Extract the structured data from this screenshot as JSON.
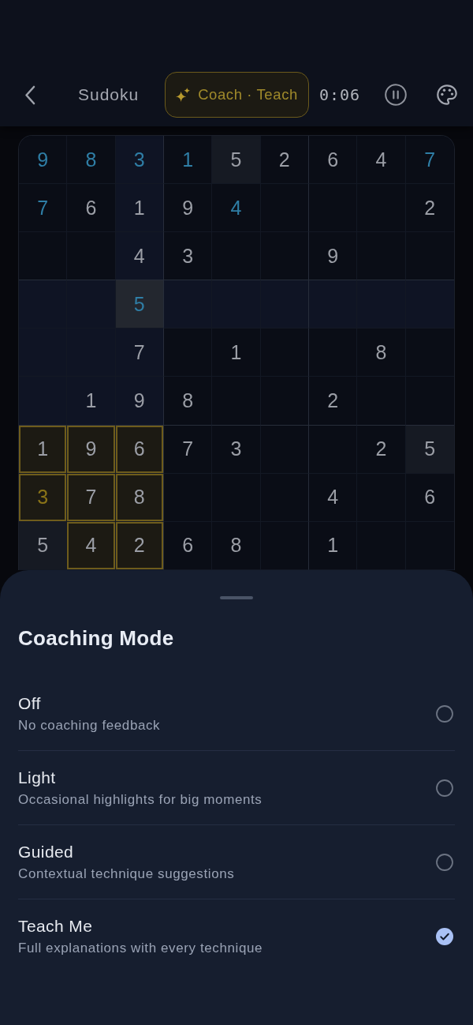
{
  "header": {
    "title": "Sudoku",
    "coach_badge": "Coach · Teach",
    "timer": "0:06"
  },
  "board": {
    "rows": [
      [
        {
          "value": "9",
          "kind": "entered",
          "selected": false,
          "coach": false
        },
        {
          "value": "8",
          "kind": "entered",
          "selected": false,
          "coach": false
        },
        {
          "value": "3",
          "kind": "entered",
          "selected": false,
          "coach": false
        },
        {
          "value": "1",
          "kind": "entered",
          "selected": false,
          "coach": false
        },
        {
          "value": "5",
          "kind": "given",
          "selected": false,
          "coach": false
        },
        {
          "value": "2",
          "kind": "given",
          "selected": false,
          "coach": false
        },
        {
          "value": "6",
          "kind": "given",
          "selected": false,
          "coach": false
        },
        {
          "value": "4",
          "kind": "given",
          "selected": false,
          "coach": false
        },
        {
          "value": "7",
          "kind": "entered",
          "selected": false,
          "coach": false
        }
      ],
      [
        {
          "value": "7",
          "kind": "entered",
          "selected": false,
          "coach": false
        },
        {
          "value": "6",
          "kind": "given",
          "selected": false,
          "coach": false
        },
        {
          "value": "1",
          "kind": "given",
          "selected": false,
          "coach": false
        },
        {
          "value": "9",
          "kind": "given",
          "selected": false,
          "coach": false
        },
        {
          "value": "4",
          "kind": "entered",
          "selected": false,
          "coach": false
        },
        {
          "selected": false,
          "coach": false
        },
        {
          "selected": false,
          "coach": false
        },
        {
          "selected": false,
          "coach": false
        },
        {
          "value": "2",
          "kind": "given",
          "selected": false,
          "coach": false
        }
      ],
      [
        {
          "selected": false,
          "coach": false
        },
        {
          "selected": false,
          "coach": false
        },
        {
          "value": "4",
          "kind": "given",
          "selected": false,
          "coach": false
        },
        {
          "value": "3",
          "kind": "given",
          "selected": false,
          "coach": false
        },
        {
          "selected": false,
          "coach": false
        },
        {
          "selected": false,
          "coach": false
        },
        {
          "value": "9",
          "kind": "given",
          "selected": false,
          "coach": false
        },
        {
          "selected": false,
          "coach": false
        },
        {
          "selected": false,
          "coach": false
        }
      ],
      [
        {
          "selected": false,
          "coach": false
        },
        {
          "selected": false,
          "coach": false
        },
        {
          "value": "5",
          "kind": "entered",
          "selected": true,
          "coach": false
        },
        {
          "selected": false,
          "coach": false
        },
        {
          "selected": false,
          "coach": false
        },
        {
          "selected": false,
          "coach": false
        },
        {
          "selected": false,
          "coach": false
        },
        {
          "selected": false,
          "coach": false
        },
        {
          "selected": false,
          "coach": false
        }
      ],
      [
        {
          "selected": false,
          "coach": false
        },
        {
          "selected": false,
          "coach": false
        },
        {
          "value": "7",
          "kind": "given",
          "selected": false,
          "coach": false
        },
        {
          "selected": false,
          "coach": false
        },
        {
          "value": "1",
          "kind": "given",
          "selected": false,
          "coach": false
        },
        {
          "selected": false,
          "coach": false
        },
        {
          "selected": false,
          "coach": false
        },
        {
          "value": "8",
          "kind": "given",
          "selected": false,
          "coach": false
        },
        {
          "selected": false,
          "coach": false
        }
      ],
      [
        {
          "selected": false,
          "coach": false
        },
        {
          "value": "1",
          "kind": "given",
          "selected": false,
          "coach": false
        },
        {
          "value": "9",
          "kind": "given",
          "selected": false,
          "coach": false
        },
        {
          "value": "8",
          "kind": "given",
          "selected": false,
          "coach": false
        },
        {
          "selected": false,
          "coach": false
        },
        {
          "selected": false,
          "coach": false
        },
        {
          "value": "2",
          "kind": "given",
          "selected": false,
          "coach": false
        },
        {
          "selected": false,
          "coach": false
        },
        {
          "selected": false,
          "coach": false
        }
      ],
      [
        {
          "value": "1",
          "kind": "given",
          "selected": false,
          "coach": true
        },
        {
          "value": "9",
          "kind": "given",
          "selected": false,
          "coach": true
        },
        {
          "value": "6",
          "kind": "given",
          "selected": false,
          "coach": true
        },
        {
          "value": "7",
          "kind": "given",
          "selected": false,
          "coach": false
        },
        {
          "value": "3",
          "kind": "given",
          "selected": false,
          "coach": false
        },
        {
          "selected": false,
          "coach": false
        },
        {
          "selected": false,
          "coach": false
        },
        {
          "value": "2",
          "kind": "given",
          "selected": false,
          "coach": false
        },
        {
          "value": "5",
          "kind": "given",
          "selected": false,
          "coach": false
        }
      ],
      [
        {
          "value": "3",
          "kind": "hint",
          "selected": false,
          "coach": true
        },
        {
          "value": "7",
          "kind": "given",
          "selected": false,
          "coach": true
        },
        {
          "value": "8",
          "kind": "given",
          "selected": false,
          "coach": true
        },
        {
          "selected": false,
          "coach": false
        },
        {
          "selected": false,
          "coach": false
        },
        {
          "selected": false,
          "coach": false
        },
        {
          "value": "4",
          "kind": "given",
          "selected": false,
          "coach": false
        },
        {
          "selected": false,
          "coach": false
        },
        {
          "value": "6",
          "kind": "given",
          "selected": false,
          "coach": false
        }
      ],
      [
        {
          "value": "5",
          "kind": "given",
          "selected": false,
          "coach": false
        },
        {
          "value": "4",
          "kind": "given",
          "selected": false,
          "coach": true
        },
        {
          "value": "2",
          "kind": "given",
          "selected": false,
          "coach": true
        },
        {
          "value": "6",
          "kind": "given",
          "selected": false,
          "coach": false
        },
        {
          "value": "8",
          "kind": "given",
          "selected": false,
          "coach": false
        },
        {
          "selected": false,
          "coach": false
        },
        {
          "value": "1",
          "kind": "given",
          "selected": false,
          "coach": false
        },
        {
          "selected": false,
          "coach": false
        },
        {
          "selected": false,
          "coach": false
        }
      ]
    ]
  },
  "sheet": {
    "title": "Coaching Mode",
    "options": [
      {
        "label": "Off",
        "description": "No coaching feedback",
        "selected": false
      },
      {
        "label": "Light",
        "description": "Occasional highlights for big moments",
        "selected": false
      },
      {
        "label": "Guided",
        "description": "Contextual technique suggestions",
        "selected": false
      },
      {
        "label": "Teach Me",
        "description": "Full explanations with every technique",
        "selected": true
      }
    ]
  }
}
